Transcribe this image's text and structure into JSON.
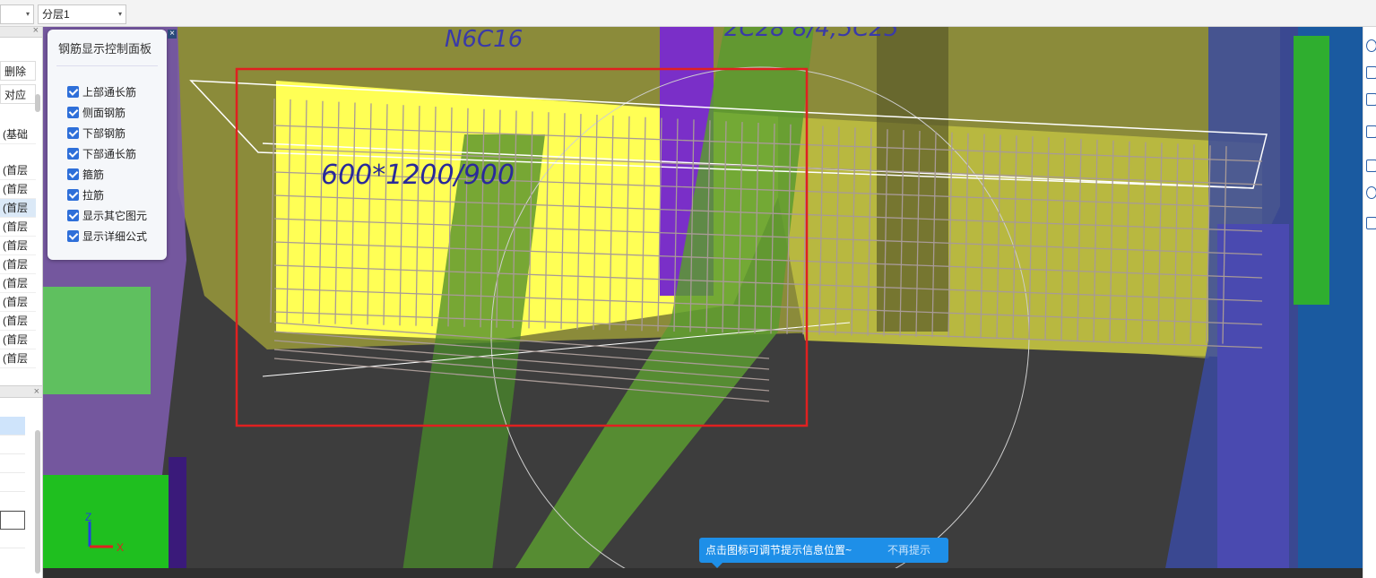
{
  "toolbar": {
    "combo_left_value": "",
    "combo_layer_value": "分层1"
  },
  "left_panel": {
    "buttons": {
      "delete_label": "删除",
      "correspond_label": "对应"
    },
    "foundation_label": "(基础",
    "rows": [
      "(首层",
      "(首层",
      "(首层",
      "(首层",
      "(首层",
      "(首层",
      "(首层",
      "(首层",
      "(首层",
      "(首层",
      "(首层"
    ],
    "selected_row_index": 2
  },
  "rebar_panel": {
    "title": "钢筋显示控制面板",
    "options": [
      {
        "label": "上部通长筋",
        "checked": true
      },
      {
        "label": "侧面钢筋",
        "checked": true
      },
      {
        "label": "下部钢筋",
        "checked": true
      },
      {
        "label": "下部通长筋",
        "checked": true
      },
      {
        "label": "箍筋",
        "checked": true
      },
      {
        "label": "拉筋",
        "checked": true
      },
      {
        "label": "显示其它图元",
        "checked": true
      },
      {
        "label": "显示详细公式",
        "checked": true
      }
    ]
  },
  "viewport": {
    "annotations": {
      "rebar_label_top": "N6C16",
      "rebar_label_top_right": "2C28 8/4;5C25",
      "beam_section": "600*1200/900"
    },
    "axes": {
      "x_label": "X",
      "z_label": "Z"
    },
    "colors": {
      "background": "#3d3d3d",
      "beam_yellow": "#ffff55",
      "slab_olive": "#8f8f3a",
      "column_purple": "#7a3fc0",
      "column_green": "#4fb030",
      "highlight_box": "#e02020",
      "rebar": "#a89a96"
    }
  },
  "toast": {
    "message": "点击图标可调节提示信息位置~",
    "dismiss": "不再提示"
  },
  "right_tools": {
    "icons": [
      "orbit-icon",
      "2d-view-icon",
      "cube-top-icon",
      "cube-icon",
      "box-select-icon",
      "3d-cube-icon",
      "list-icon"
    ]
  }
}
